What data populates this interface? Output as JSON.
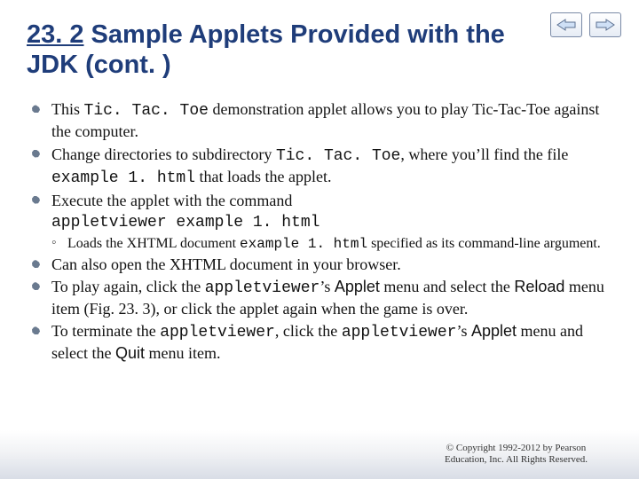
{
  "nav": {
    "back_icon": "back-arrow-icon",
    "forward_icon": "forward-arrow-icon"
  },
  "title": {
    "section_number": "23. 2",
    "rest": "  Sample Applets Provided with the JDK (cont. )"
  },
  "bullets": {
    "b1": {
      "pre": "This ",
      "code1": "Tic. Tac. Toe",
      "post": " demonstration applet allows you to play Tic-Tac-Toe against the computer."
    },
    "b2": {
      "pre": "Change directories to subdirectory ",
      "code1": "Tic. Tac. Toe",
      "mid": ", where you’ll find the file ",
      "code2": "example 1. html",
      "post": " that loads the applet."
    },
    "b3": {
      "pre": "Execute the applet with the command",
      "code_line": "appletviewer example 1. html",
      "sub": {
        "pre": "Loads the XHTML document ",
        "code": "example 1. html",
        "post": " specified as its command-line argument."
      }
    },
    "b4": {
      "text": "Can also open the XHTML document in your browser."
    },
    "b5": {
      "pre": "To play again, click the ",
      "code1": "appletviewer",
      "mid1": "’s ",
      "sans1": "Applet",
      "mid2": " menu and select the ",
      "sans2": "Reload",
      "post": " menu item (Fig. 23. 3), or click the applet again when the game is over."
    },
    "b6": {
      "pre": "To terminate the ",
      "code1": "appletviewer",
      "mid1": ", click the ",
      "code2": "appletviewer",
      "mid2": "’s ",
      "sans1": "Applet",
      "mid3": " menu and select the ",
      "sans2": "Quit",
      "post": " menu item."
    }
  },
  "footer": "© Copyright 1992-2012 by Pearson\nEducation, Inc. All Rights Reserved."
}
